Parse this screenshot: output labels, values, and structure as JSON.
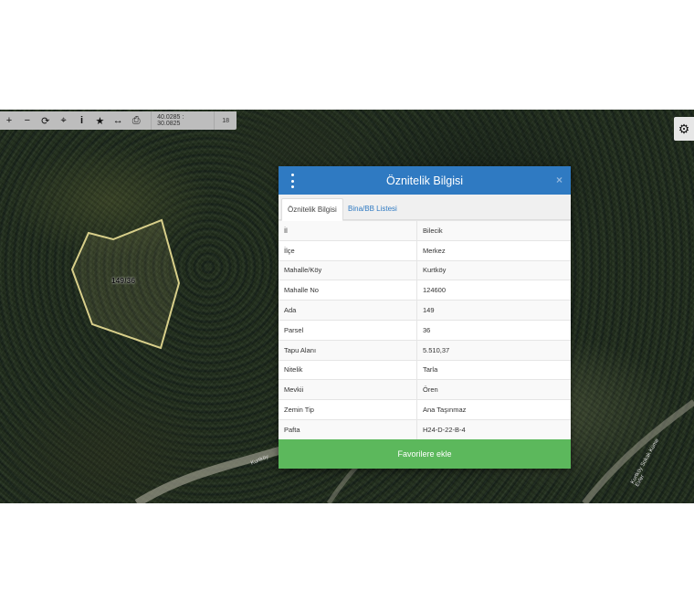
{
  "toolbar": {
    "icons": [
      "zoom-in",
      "zoom-out",
      "refresh",
      "locate",
      "info",
      "favorites",
      "measure",
      "print"
    ],
    "glyphs": [
      "+",
      "−",
      "⟳",
      "⌖",
      "i",
      "★",
      "↔",
      "⎙"
    ],
    "coordinates": "40.0285 : 30.0825",
    "zoom": "18"
  },
  "map": {
    "parcel_label": "149/36",
    "road_labels": [
      "Kurtköy",
      "Kurtköy Sokak Küme Evler"
    ]
  },
  "modal": {
    "title": "Öznitelik Bilgisi",
    "close": "×",
    "tabs": [
      {
        "label": "Öznitelik Bilgisi",
        "active": true
      },
      {
        "label": "Bina/BB Listesi",
        "active": false
      }
    ],
    "rows": [
      {
        "key": "İl",
        "value": "Bilecik"
      },
      {
        "key": "İlçe",
        "value": "Merkez"
      },
      {
        "key": "Mahalle/Köy",
        "value": "Kurtköy"
      },
      {
        "key": "Mahalle No",
        "value": "124600"
      },
      {
        "key": "Ada",
        "value": "149"
      },
      {
        "key": "Parsel",
        "value": "36"
      },
      {
        "key": "Tapu Alanı",
        "value": "5.510,37"
      },
      {
        "key": "Nitelik",
        "value": "Tarla"
      },
      {
        "key": "Mevkii",
        "value": "Ören"
      },
      {
        "key": "Zemin Tip",
        "value": "Ana Taşınmaz"
      },
      {
        "key": "Pafta",
        "value": "H24-D-22-B-4"
      }
    ],
    "favorite_button": "Favorilere ekle"
  },
  "colors": {
    "header": "#2f7ac2",
    "favorite_button": "#5cb85c",
    "parcel_outline": "#d8cf8a"
  }
}
